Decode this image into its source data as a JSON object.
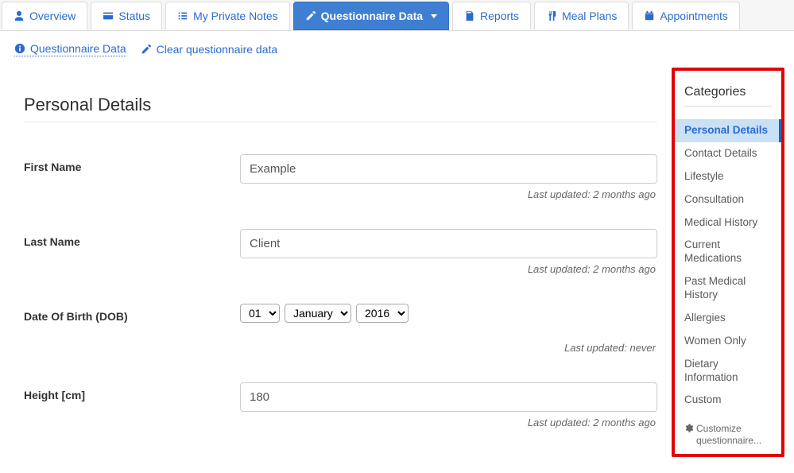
{
  "tabs": {
    "overview": "Overview",
    "status": "Status",
    "notes": "My Private Notes",
    "questionnaire": "Questionnaire Data",
    "reports": "Reports",
    "meals": "Meal Plans",
    "appointments": "Appointments"
  },
  "sublinks": {
    "data": "Questionnaire Data",
    "clear": "Clear questionnaire data"
  },
  "section": {
    "title": "Personal Details"
  },
  "fields": {
    "first_name": {
      "label": "First Name",
      "value": "Example",
      "updated": "Last updated: 2 months ago"
    },
    "last_name": {
      "label": "Last Name",
      "value": "Client",
      "updated": "Last updated: 2 months ago"
    },
    "dob": {
      "label": "Date Of Birth (DOB)",
      "day": "01",
      "month": "January",
      "year": "2016",
      "updated": "Last updated: never"
    },
    "height": {
      "label": "Height [cm]",
      "value": "180",
      "updated": "Last updated: 2 months ago"
    }
  },
  "categories": {
    "title": "Categories",
    "items": [
      "Personal Details",
      "Contact Details",
      "Lifestyle",
      "Consultation",
      "Medical History",
      "Current Medications",
      "Past Medical History",
      "Allergies",
      "Women Only",
      "Dietary Information",
      "Custom"
    ],
    "customize": "Customize questionnaire..."
  }
}
